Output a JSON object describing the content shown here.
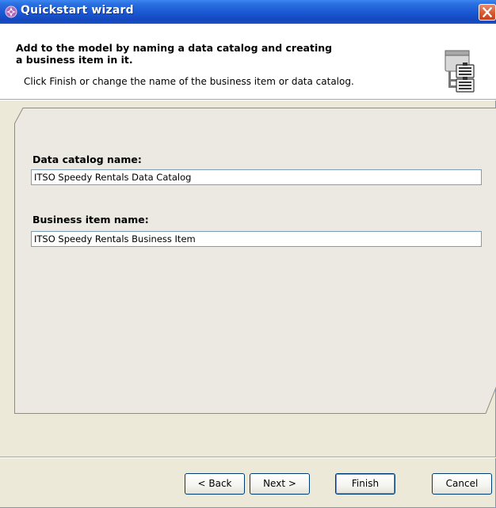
{
  "window": {
    "title": "Quickstart wizard"
  },
  "header": {
    "title": "Add to the model by naming a data catalog and creating a business item in it.",
    "description": "Click Finish or change the name of the business item or data catalog."
  },
  "form": {
    "catalog_label": "Data catalog name:",
    "catalog_value": "ITSO Speedy Rentals Data Catalog",
    "business_item_label": "Business item name:",
    "business_item_value": "ITSO Speedy Rentals Business Item"
  },
  "buttons": {
    "back": "< Back",
    "next": "Next >",
    "finish": "Finish",
    "cancel": "Cancel"
  },
  "colors": {
    "titlebar": "#1a57d2",
    "close_button": "#d8552f",
    "dialog_background": "#ece9d8",
    "field_border": "#7f9db9"
  },
  "icons": {
    "app": "purple-compass-icon",
    "close": "close-x-icon",
    "header": "data-catalog-icon"
  }
}
